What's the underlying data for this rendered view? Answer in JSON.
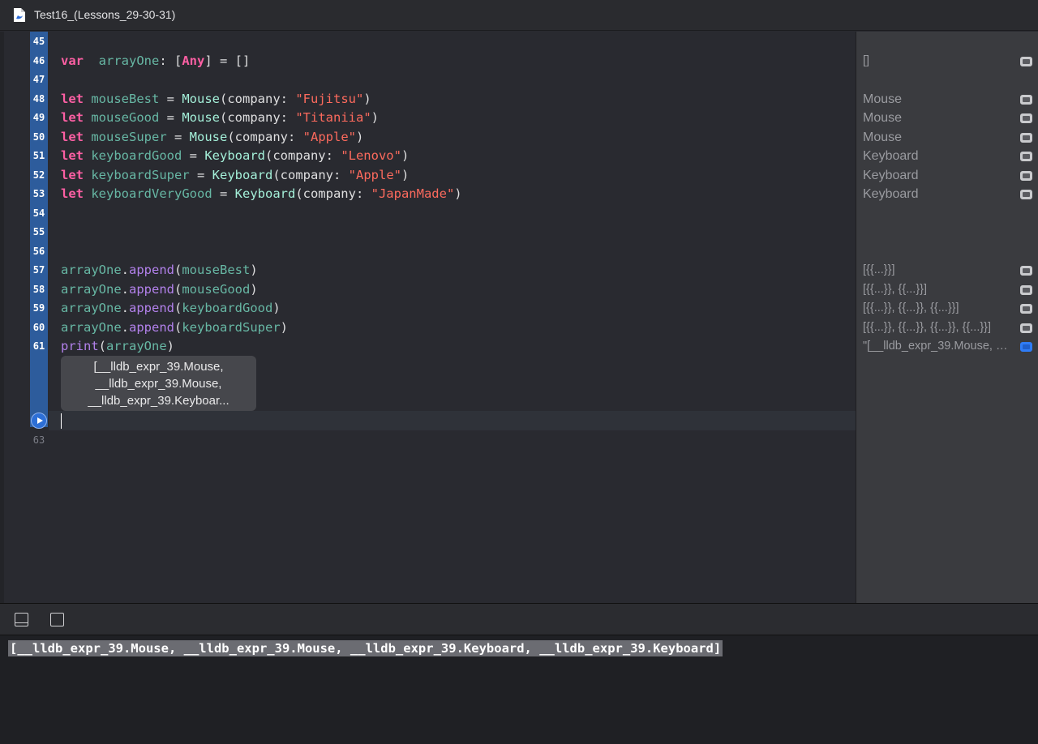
{
  "window": {
    "title": "Test16_(Lessons_29-30-31)"
  },
  "editor": {
    "lines": [
      {
        "num": "45",
        "parts": []
      },
      {
        "num": "46",
        "parts": [
          [
            "kw",
            "var"
          ],
          [
            "",
            "  "
          ],
          [
            "var",
            "arrayOne"
          ],
          [
            "",
            ": ["
          ],
          [
            "kw",
            "Any"
          ],
          [
            "",
            "] = []"
          ]
        ]
      },
      {
        "num": "47",
        "parts": []
      },
      {
        "num": "48",
        "parts": [
          [
            "kw",
            "let"
          ],
          [
            "",
            " "
          ],
          [
            "var",
            "mouseBest"
          ],
          [
            "",
            " = "
          ],
          [
            "typ",
            "Mouse"
          ],
          [
            "",
            "(company: "
          ],
          [
            "str",
            "\"Fujitsu\""
          ],
          [
            "",
            ")"
          ]
        ]
      },
      {
        "num": "49",
        "parts": [
          [
            "kw",
            "let"
          ],
          [
            "",
            " "
          ],
          [
            "var",
            "mouseGood"
          ],
          [
            "",
            " = "
          ],
          [
            "typ",
            "Mouse"
          ],
          [
            "",
            "(company: "
          ],
          [
            "str",
            "\"Titaniia\""
          ],
          [
            "",
            ")"
          ]
        ]
      },
      {
        "num": "50",
        "parts": [
          [
            "kw",
            "let"
          ],
          [
            "",
            " "
          ],
          [
            "var",
            "mouseSuper"
          ],
          [
            "",
            " = "
          ],
          [
            "typ",
            "Mouse"
          ],
          [
            "",
            "(company: "
          ],
          [
            "str",
            "\"Apple\""
          ],
          [
            "",
            ")"
          ]
        ]
      },
      {
        "num": "51",
        "parts": [
          [
            "kw",
            "let"
          ],
          [
            "",
            " "
          ],
          [
            "var",
            "keyboardGood"
          ],
          [
            "",
            " = "
          ],
          [
            "typ",
            "Keyboard"
          ],
          [
            "",
            "(company: "
          ],
          [
            "str",
            "\"Lenovo\""
          ],
          [
            "",
            ")"
          ]
        ]
      },
      {
        "num": "52",
        "parts": [
          [
            "kw",
            "let"
          ],
          [
            "",
            " "
          ],
          [
            "var",
            "keyboardSuper"
          ],
          [
            "",
            " = "
          ],
          [
            "typ",
            "Keyboard"
          ],
          [
            "",
            "(company: "
          ],
          [
            "str",
            "\"Apple\""
          ],
          [
            "",
            ")"
          ]
        ]
      },
      {
        "num": "53",
        "parts": [
          [
            "kw",
            "let"
          ],
          [
            "",
            " "
          ],
          [
            "var",
            "keyboardVeryGood"
          ],
          [
            "",
            " = "
          ],
          [
            "typ",
            "Keyboard"
          ],
          [
            "",
            "(company: "
          ],
          [
            "str",
            "\"JapanMade\""
          ],
          [
            "",
            ")"
          ]
        ]
      },
      {
        "num": "54",
        "parts": []
      },
      {
        "num": "55",
        "parts": []
      },
      {
        "num": "56",
        "parts": []
      },
      {
        "num": "57",
        "parts": [
          [
            "var",
            "arrayOne"
          ],
          [
            "",
            "."
          ],
          [
            "fn",
            "append"
          ],
          [
            "",
            "("
          ],
          [
            "var",
            "mouseBest"
          ],
          [
            "",
            ")"
          ]
        ]
      },
      {
        "num": "58",
        "parts": [
          [
            "var",
            "arrayOne"
          ],
          [
            "",
            "."
          ],
          [
            "fn",
            "append"
          ],
          [
            "",
            "("
          ],
          [
            "var",
            "mouseGood"
          ],
          [
            "",
            ")"
          ]
        ]
      },
      {
        "num": "59",
        "parts": [
          [
            "var",
            "arrayOne"
          ],
          [
            "",
            "."
          ],
          [
            "fn",
            "append"
          ],
          [
            "",
            "("
          ],
          [
            "var",
            "keyboardGood"
          ],
          [
            "",
            ")"
          ]
        ]
      },
      {
        "num": "60",
        "parts": [
          [
            "var",
            "arrayOne"
          ],
          [
            "",
            "."
          ],
          [
            "fn",
            "append"
          ],
          [
            "",
            "("
          ],
          [
            "var",
            "keyboardSuper"
          ],
          [
            "",
            ")"
          ]
        ]
      },
      {
        "num": "61",
        "parts": [
          [
            "fn",
            "print"
          ],
          [
            "",
            "("
          ],
          [
            "var",
            "arrayOne"
          ],
          [
            "",
            ")"
          ]
        ]
      }
    ],
    "last_line_number": "63",
    "tooltip_lines": [
      "[__lldb_expr_39.Mouse,",
      "__lldb_expr_39.Mouse,",
      "__lldb_expr_39.Keyboar..."
    ]
  },
  "results": [
    {
      "line": "46",
      "text": "[]"
    },
    {
      "line": "48",
      "text": "Mouse"
    },
    {
      "line": "49",
      "text": "Mouse"
    },
    {
      "line": "50",
      "text": "Mouse"
    },
    {
      "line": "51",
      "text": "Keyboard"
    },
    {
      "line": "52",
      "text": "Keyboard"
    },
    {
      "line": "53",
      "text": "Keyboard"
    },
    {
      "line": "57",
      "text": "[{{...}}]"
    },
    {
      "line": "58",
      "text": "[{{...}}, {{...}}]"
    },
    {
      "line": "59",
      "text": "[{{...}}, {{...}}, {{...}}]"
    },
    {
      "line": "60",
      "text": "[{{...}}, {{...}}, {{...}}, {{...}}]"
    },
    {
      "line": "61",
      "text": "\"[__lldb_expr_39.Mouse, __lldb_expr_39.Mouse, __lldb_expr_39.Keyboard, __lldb_expr_39.Keyboard]\\n\"",
      "active": true
    }
  ],
  "console": {
    "output": "[__lldb_expr_39.Mouse, __lldb_expr_39.Mouse, __lldb_expr_39.Keyboard, __lldb_expr_39.Keyboard]"
  },
  "colors": {
    "keyword": "#fc5fa3",
    "variable": "#67b7a4",
    "type": "#a4f0d9",
    "string": "#fc6a5d",
    "function": "#b281eb",
    "gutter_highlight": "#2d5c9c"
  },
  "icons": [
    "file-icon",
    "run-button-icon",
    "quick-look-icon",
    "hide-debug-area-icon",
    "console-toggle-icon"
  ]
}
